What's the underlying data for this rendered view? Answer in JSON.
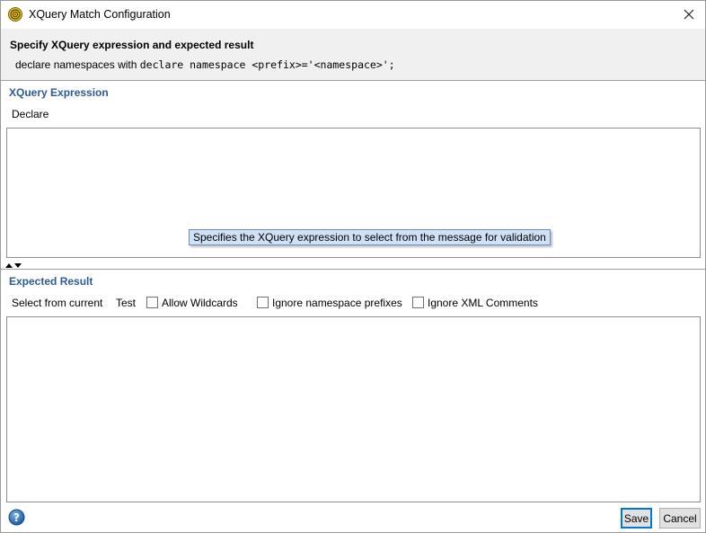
{
  "window": {
    "title": "XQuery Match Configuration"
  },
  "header": {
    "title": "Specify XQuery expression and expected result",
    "desc_prefix": "declare namespaces with ",
    "desc_code": "declare namespace <prefix>='<namespace>';"
  },
  "xquery_section": {
    "title": "XQuery Expression",
    "declare_label": "Declare",
    "expression_value": "",
    "tooltip": "Specifies the XQuery expression to select from the message for validation"
  },
  "expected_section": {
    "title": "Expected Result",
    "select_from_current_label": "Select from current",
    "test_label": "Test",
    "allow_wildcards_label": "Allow Wildcards",
    "ignore_ns_prefixes_label": "Ignore namespace prefixes",
    "ignore_xml_comments_label": "Ignore XML Comments",
    "result_value": ""
  },
  "buttons": {
    "save": "Save",
    "cancel": "Cancel"
  },
  "colors": {
    "section_title": "#2b5b97",
    "tooltip_bg": "#cfe0f7",
    "default_button_border": "#0078d7"
  },
  "icons": {
    "app": "soapui-target-icon",
    "close": "close-icon",
    "help": "help-icon",
    "splitter": "expand-collapse-icon"
  }
}
